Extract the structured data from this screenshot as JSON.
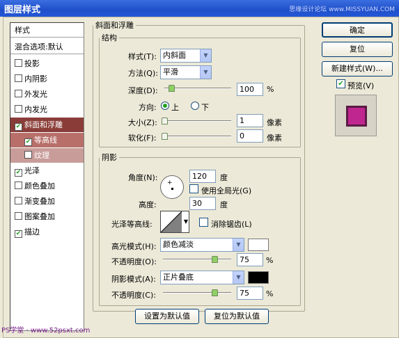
{
  "window": {
    "title": "图层样式",
    "watermark": "思缘设计论坛 www.MISSYUAN.COM"
  },
  "left_panel": {
    "items": [
      {
        "label": "样式",
        "type": "header"
      },
      {
        "label": "混合选项:默认",
        "type": "header"
      },
      {
        "label": "投影",
        "checked": false
      },
      {
        "label": "内阴影",
        "checked": false
      },
      {
        "label": "外发光",
        "checked": false
      },
      {
        "label": "内发光",
        "checked": false
      },
      {
        "label": "斜面和浮雕",
        "checked": true,
        "selected": true
      },
      {
        "label": "等高线",
        "checked": true,
        "sub": true
      },
      {
        "label": "纹理",
        "checked": false,
        "sub": true
      },
      {
        "label": "光泽",
        "checked": true
      },
      {
        "label": "颜色叠加",
        "checked": false
      },
      {
        "label": "渐变叠加",
        "checked": false
      },
      {
        "label": "图案叠加",
        "checked": false
      },
      {
        "label": "描边",
        "checked": true
      }
    ],
    "footer": "PS学堂 · www.52psxt.com"
  },
  "bevel": {
    "group_title": "斜面和浮雕",
    "structure": {
      "title": "结构",
      "style_label": "样式(T):",
      "style_value": "内斜面",
      "technique_label": "方法(Q):",
      "technique_value": "平滑",
      "depth_label": "深度(D):",
      "depth_value": "100",
      "depth_unit": "%",
      "depth_level": 0.1,
      "direction_label": "方向:",
      "dir_up": "上",
      "dir_down": "下",
      "direction": "up",
      "size_label": "大小(Z):",
      "size_value": "1",
      "size_unit": "像素",
      "size_level": 0.0,
      "soften_label": "软化(F):",
      "soften_value": "0",
      "soften_unit": "像素",
      "soften_level": 0.0
    },
    "shading": {
      "title": "阴影",
      "angle_label": "角度(N):",
      "angle_value": "120",
      "angle_unit": "度",
      "global_light_label": "使用全局光(G)",
      "global_light": false,
      "altitude_label": "高度:",
      "altitude_value": "30",
      "altitude_unit": "度",
      "gloss_label": "光泽等高线:",
      "antialias_label": "消除锯齿(L)",
      "antialias": false,
      "highlight_mode_label": "高光模式(H):",
      "highlight_mode": "颜色减淡",
      "highlight_color": "#ffffff",
      "highlight_opacity_label": "不透明度(O):",
      "highlight_opacity": "75",
      "highlight_opacity_unit": "%",
      "highlight_level": 0.75,
      "shadow_mode_label": "阴影模式(A):",
      "shadow_mode": "正片叠底",
      "shadow_color": "#000000",
      "shadow_opacity_label": "不透明度(C):",
      "shadow_opacity": "75",
      "shadow_opacity_unit": "%",
      "shadow_level": 0.75
    },
    "make_default": "设置为默认值",
    "reset_default": "复位为默认值"
  },
  "right": {
    "ok": "确定",
    "reset": "复位",
    "new_style": "新建样式(W)...",
    "preview_label": "预览(V)",
    "preview": true,
    "preview_color": "#c0268f"
  }
}
